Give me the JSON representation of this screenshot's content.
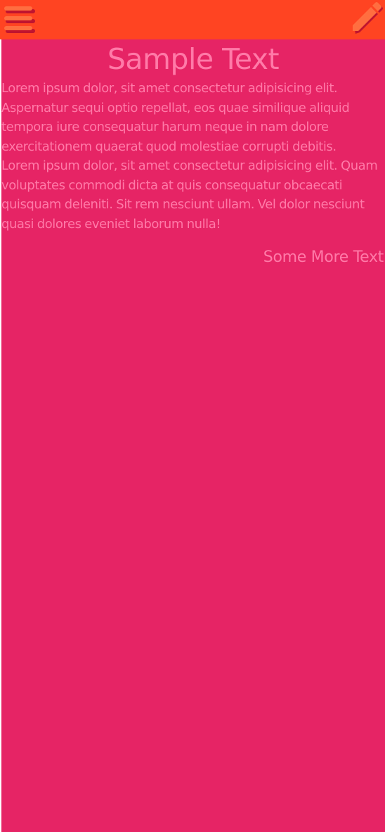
{
  "toolbar": {
    "menu_icon": "menu-icon",
    "edit_icon": "pencil-icon",
    "color": "#FF4422"
  },
  "main": {
    "title": "Sample Text",
    "paragraphs": [
      "Lorem ipsum dolor, sit amet consectetur adipisicing elit. Aspernatur sequi optio repellat, eos quae similique aliquid tempora iure consequatur harum neque in nam dolore exercitationem quaerat quod molestiae corrupti debitis.",
      "Lorem ipsum dolor, sit amet consectetur adipisicing elit. Quam voluptates commodi dicta at quis consequatur obcaecati quisquam deleniti. Sit rem nesciunt ullam. Vel dolor nesciunt quasi dolores eveniet laborum nulla!"
    ],
    "more_text": "Some More Text",
    "background_color": "#E62465",
    "text_color": "#FF7AA8"
  }
}
